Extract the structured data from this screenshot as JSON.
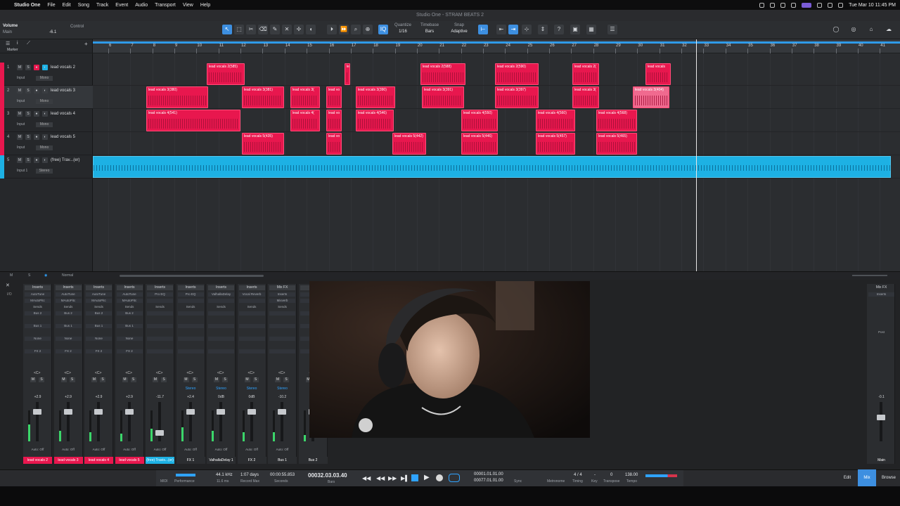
{
  "menubar": {
    "apple": "",
    "app": "Studio One",
    "items": [
      "File",
      "Edit",
      "Song",
      "Track",
      "Event",
      "Audio",
      "Transport",
      "View",
      "Help"
    ],
    "clock": "Tue Mar 10  11:45 PM"
  },
  "window": {
    "title": "Studio One - STRAM BEATS 2"
  },
  "toolbar": {
    "param": "Volume",
    "param_sub": "Main",
    "param_val": "-6.1",
    "control": "Control",
    "quantize_label": "Quantize",
    "quantize_val": "1/16",
    "timebase_label": "Timebase",
    "timebase_val": "Bars",
    "snap_label": "Snap",
    "snap_val": "Adaptive"
  },
  "marker": {
    "label": "Marker"
  },
  "ruler": {
    "ticks": [
      "6",
      "7",
      "8",
      "9",
      "10",
      "11",
      "12",
      "13",
      "14",
      "15",
      "16",
      "17",
      "18",
      "19",
      "20",
      "21",
      "22",
      "23",
      "24",
      "25",
      "26",
      "27",
      "28",
      "29",
      "30",
      "31",
      "32",
      "33",
      "34",
      "35",
      "36",
      "37",
      "38",
      "39",
      "40",
      "41"
    ]
  },
  "tracks": [
    {
      "num": "1",
      "name": "lead vocals 2",
      "input": "Input",
      "mode": "Mono",
      "color": "#e8174e"
    },
    {
      "num": "2",
      "name": "lead vocals 3",
      "input": "Input",
      "mode": "Mono",
      "color": "#e8174e"
    },
    {
      "num": "3",
      "name": "lead vocals 4",
      "input": "Input",
      "mode": "Mono",
      "color": "#e8174e"
    },
    {
      "num": "4",
      "name": "lead vocals 5",
      "input": "Input",
      "mode": "Mono",
      "color": "#e8174e"
    },
    {
      "num": "5",
      "name": "(free) Trav...(er)",
      "input": "Input 1",
      "mode": "Stereo",
      "color": "#1db1e4"
    }
  ],
  "clips": [
    {
      "lane": 0,
      "name": "lead vocals 2(585)"
    },
    {
      "lane": 0,
      "name": "le"
    },
    {
      "lane": 0,
      "name": "lead vocals 2(588)"
    },
    {
      "lane": 0,
      "name": "lead vocals 2(590)"
    },
    {
      "lane": 0,
      "name": "lead vocals 2("
    },
    {
      "lane": 0,
      "name": "lead vocals"
    },
    {
      "lane": 1,
      "name": "lead vocals 3(380)"
    },
    {
      "lane": 1,
      "name": "lead vocals 3(381)"
    },
    {
      "lane": 1,
      "name": "lead vocals 3("
    },
    {
      "lane": 1,
      "name": "lead vo"
    },
    {
      "lane": 1,
      "name": "lead vocals 3(390)"
    },
    {
      "lane": 1,
      "name": "lead vocals 3(391)"
    },
    {
      "lane": 1,
      "name": "lead vocals 3(397)"
    },
    {
      "lane": 1,
      "name": "lead vocals 3("
    },
    {
      "lane": 1,
      "name": "lead vocals 3(404)"
    },
    {
      "lane": 2,
      "name": "lead vocals 4(541)"
    },
    {
      "lane": 2,
      "name": "lead vocals 4("
    },
    {
      "lane": 2,
      "name": "lead vo"
    },
    {
      "lane": 2,
      "name": "lead vocals 4(546)"
    },
    {
      "lane": 2,
      "name": "lead vocals 4(550)"
    },
    {
      "lane": 2,
      "name": "lead vocals 4(560)"
    },
    {
      "lane": 2,
      "name": "lead vocals 4(568)"
    },
    {
      "lane": 3,
      "name": "lead vocals 5(435)"
    },
    {
      "lane": 3,
      "name": "lead vo"
    },
    {
      "lane": 3,
      "name": "lead vocals 5(442)"
    },
    {
      "lane": 3,
      "name": "lead vocals 5(446)"
    },
    {
      "lane": 3,
      "name": "lead vocals 5(457)"
    },
    {
      "lane": 3,
      "name": "lead vocals 5(465)"
    }
  ],
  "bottombar": {
    "mode": "Normal"
  },
  "mixer": {
    "channels": [
      {
        "name": "lead vocals 2",
        "num": "1",
        "vol": "+2.9",
        "ins": "Inserts",
        "slot1": "AutoTune",
        "slot2": "MAutoPitc",
        "sends": "Sends",
        "bus": "Bus 2",
        "bus2": "Bus 1",
        "fx": "None",
        "fx2": "FX 2",
        "auto": "Auto: Off",
        "color": "#e8174e"
      },
      {
        "name": "lead vocals 3",
        "num": "2",
        "vol": "+2.9",
        "ins": "Inserts",
        "slot1": "AutoTune",
        "slot2": "MAutoPitc",
        "sends": "Sends",
        "bus": "Bus 2",
        "bus2": "Bus 1",
        "fx": "None",
        "fx2": "FX 2",
        "auto": "Auto: Off",
        "color": "#e8174e"
      },
      {
        "name": "lead vocals 4",
        "num": "3",
        "vol": "+2.9",
        "ins": "Inserts",
        "slot1": "AutoTune",
        "slot2": "MAutoPitc",
        "sends": "Sends",
        "bus": "Bus 2",
        "bus2": "Bus 1",
        "fx": "None",
        "fx2": "FX 2",
        "auto": "Auto: Off",
        "color": "#e8174e"
      },
      {
        "name": "lead vocals 5",
        "num": "4",
        "vol": "+2.9",
        "ins": "Inserts",
        "slot1": "AutoTune",
        "slot2": "MAutoPitc",
        "sends": "Sends",
        "bus": "Bus 2",
        "bus2": "Bus 1",
        "fx": "None",
        "fx2": "FX 2",
        "auto": "Auto: Off",
        "color": "#e8174e"
      },
      {
        "name": "(free) Travis...(er)",
        "num": "5",
        "vol": "-11.7",
        "ins": "Inserts",
        "slot1": "Pro EQ",
        "slot2": "",
        "sends": "Sends",
        "bus": "",
        "bus2": "",
        "fx": "",
        "fx2": "",
        "auto": "Auto: Off",
        "color": "#1db1e4"
      },
      {
        "name": "FX 1",
        "num": "6",
        "vol": "+2.4",
        "ins": "Inserts",
        "slot1": "Pro EQ",
        "slot2": "",
        "sends": "Sends",
        "bus": "",
        "bus2": "",
        "fx": "",
        "fx2": "",
        "auto": "Auto: Off",
        "color": "#2b2d30",
        "out": "Stereo"
      },
      {
        "name": "ValhallaDelay 1",
        "num": "7",
        "vol": "0dB",
        "ins": "Inserts",
        "slot1": "ValhallaDelay",
        "slot2": "",
        "sends": "Sends",
        "bus": "",
        "bus2": "",
        "fx": "",
        "fx2": "",
        "auto": "Auto: Off",
        "color": "#2b2d30",
        "out": "Stereo"
      },
      {
        "name": "FX 2",
        "num": "8",
        "vol": "0dB",
        "ins": "Inserts",
        "slot1": "Vocal Reverb",
        "slot2": "",
        "sends": "Sends",
        "bus": "",
        "bus2": "",
        "fx": "",
        "fx2": "",
        "auto": "Auto: Off",
        "color": "#2b2d30",
        "out": "Stereo"
      },
      {
        "name": "Bus 1",
        "num": "9",
        "vol": "-10.2",
        "ins": "Mix FX",
        "slot1": "Inserts",
        "slot2": "Mixverb",
        "sends": "Sends",
        "bus": "",
        "bus2": "",
        "fx": "",
        "fx2": "",
        "auto": "Auto: Off",
        "color": "#2b2d30",
        "out": "Stereo"
      },
      {
        "name": "Bus 2",
        "num": "10",
        "vol": "",
        "ins": "",
        "slot1": "",
        "slot2": "",
        "sends": "",
        "bus": "",
        "bus2": "",
        "fx": "",
        "fx2": "",
        "auto": "",
        "color": "#2b2d30"
      }
    ],
    "main": {
      "label": "Mix FX",
      "inserts": "Inserts",
      "post": "Post",
      "vol": "-0.1",
      "name": "Main"
    }
  },
  "transport": {
    "midi": "MIDI",
    "perf": "Performance",
    "rate": "44.1 kHz",
    "latency": "11.6 ms",
    "record_max": "1:07 days",
    "record_max_label": "Record Max",
    "seconds": "00:00:55.853",
    "seconds_label": "Seconds",
    "bars": "00032.03.03.40",
    "bars_label": "Bars",
    "loop_start": "00001.01.01.00",
    "loop_end": "00077.01.01.00",
    "sync": "Sync",
    "metronome": "Metronome",
    "signature": "4 / 4",
    "timing": "Timing",
    "key": "-",
    "key_label": "Key",
    "transpose": "0",
    "transpose_label": "Transpose",
    "tempo": "138.00",
    "tempo_label": "Tempo"
  },
  "tabs": {
    "edit": "Edit",
    "mix": "Mix",
    "browse": "Browse"
  },
  "colors": {
    "accent": "#3d8fe0",
    "clip": "#e8174e",
    "audio": "#1db1e4"
  }
}
